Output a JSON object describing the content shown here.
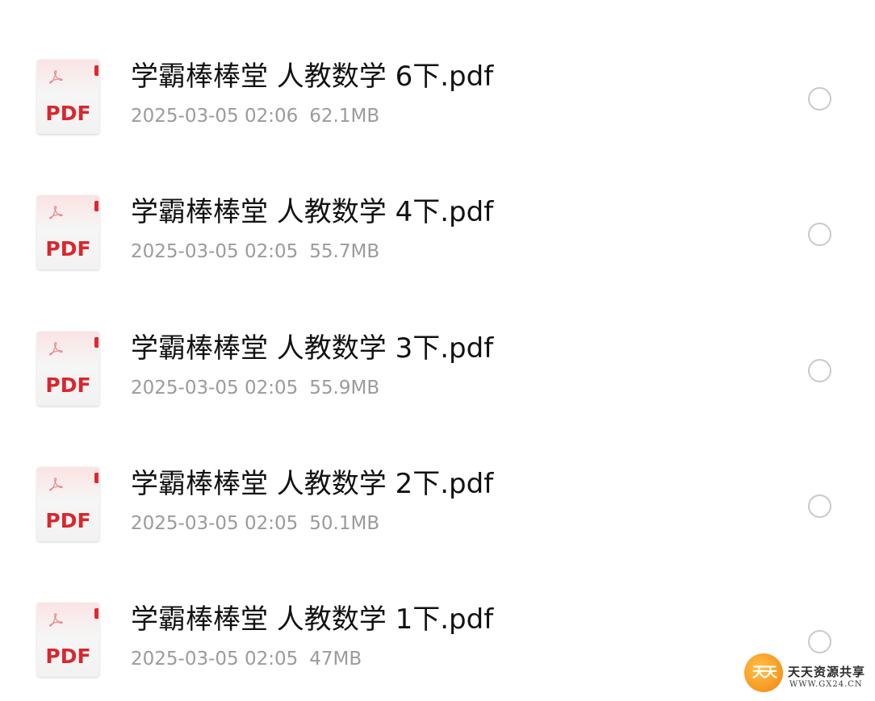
{
  "files": [
    {
      "name": "学霸棒棒堂 人教数学 6下.pdf",
      "date": "2025-03-05 02:06",
      "size": "62.1MB",
      "icon": "pdf-icon",
      "icon_label": "PDF",
      "selected": false
    },
    {
      "name": "学霸棒棒堂 人教数学 4下.pdf",
      "date": "2025-03-05 02:05",
      "size": "55.7MB",
      "icon": "pdf-icon",
      "icon_label": "PDF",
      "selected": false
    },
    {
      "name": "学霸棒棒堂 人教数学 3下.pdf",
      "date": "2025-03-05 02:05",
      "size": "55.9MB",
      "icon": "pdf-icon",
      "icon_label": "PDF",
      "selected": false
    },
    {
      "name": "学霸棒棒堂 人教数学 2下.pdf",
      "date": "2025-03-05 02:05",
      "size": "50.1MB",
      "icon": "pdf-icon",
      "icon_label": "PDF",
      "selected": false
    },
    {
      "name": "学霸棒棒堂 人教数学 1下.pdf",
      "date": "2025-03-05 02:05",
      "size": "47MB",
      "icon": "pdf-icon",
      "icon_label": "PDF",
      "selected": false
    }
  ],
  "watermark": {
    "logo_text": "天天",
    "title": "天天资源共享",
    "url": "WWW.GX24.CN"
  },
  "colors": {
    "pdf_red": "#d8272d",
    "name_text": "#121212",
    "meta_text": "#9b9b9b",
    "radio_border": "#c9c9c9",
    "watermark_orange": "#f7951e"
  }
}
